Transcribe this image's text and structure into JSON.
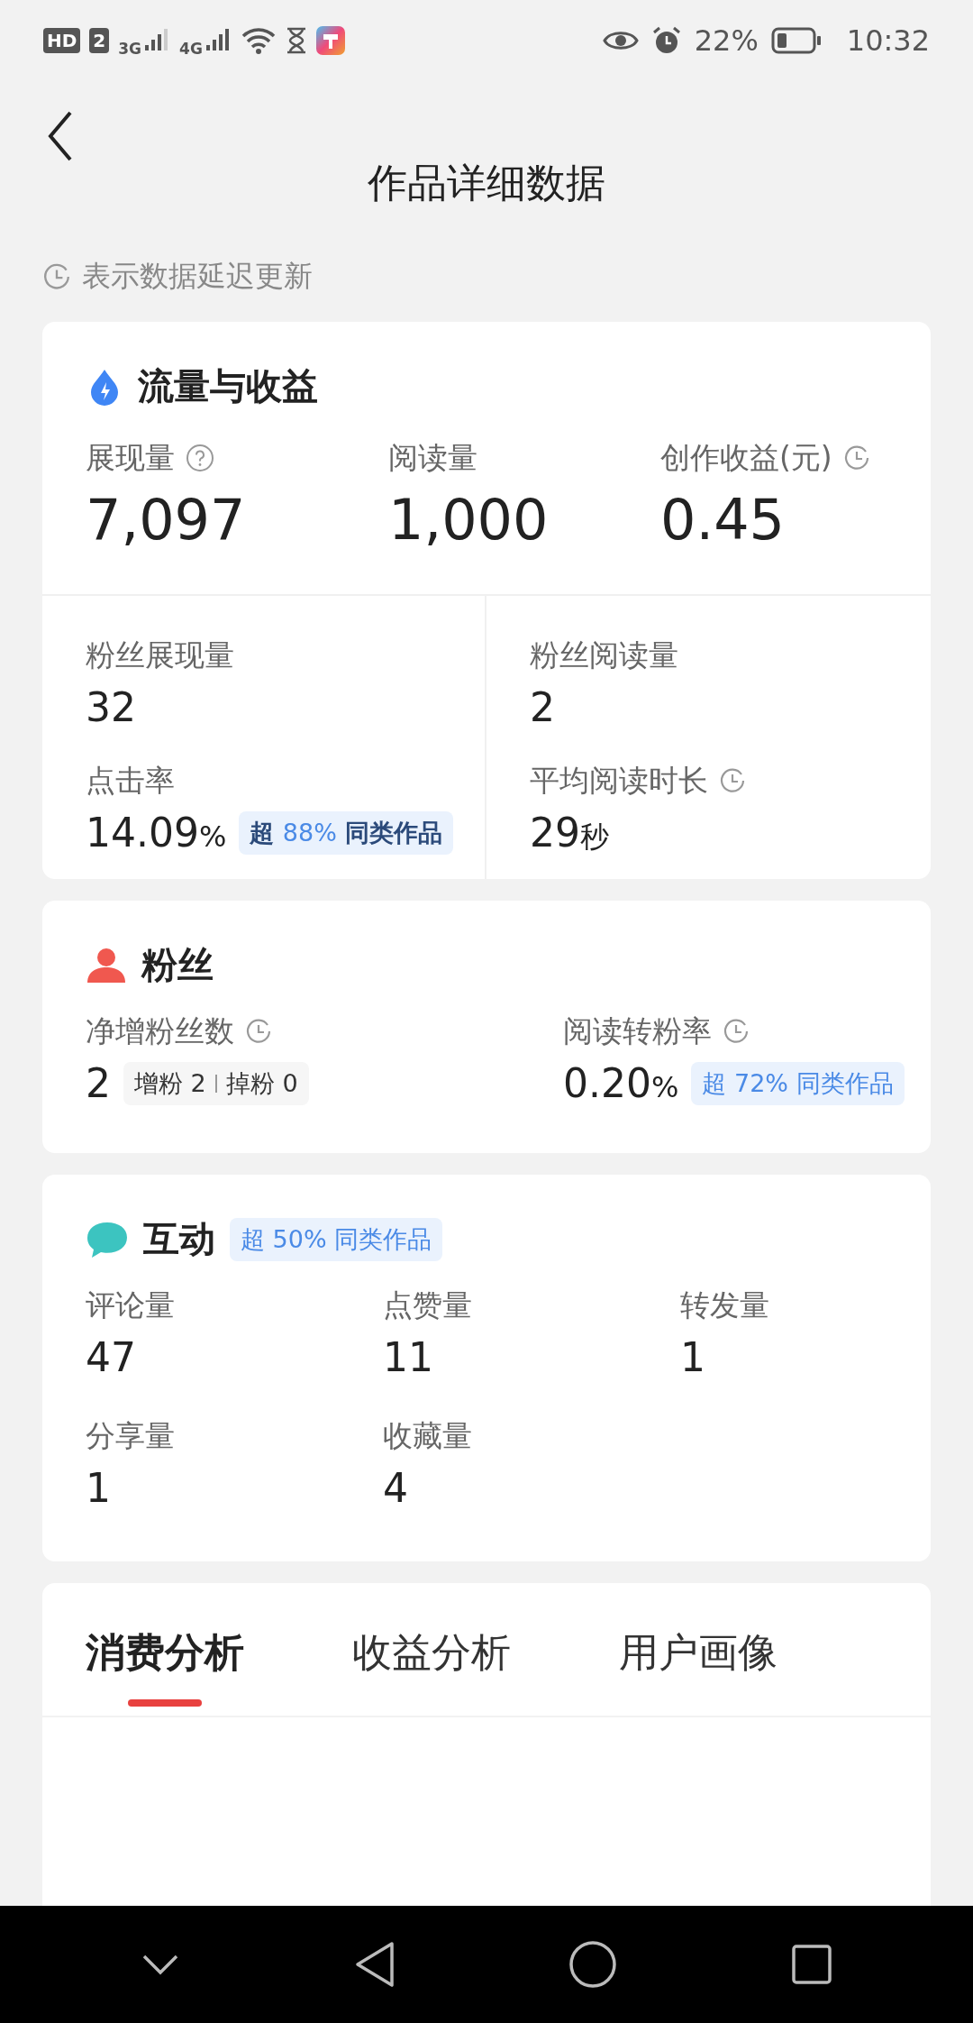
{
  "status_bar": {
    "sim_badges": [
      "HD",
      "2"
    ],
    "networks": [
      "3G",
      "4G"
    ],
    "battery": "22%",
    "time": "10:32"
  },
  "header": {
    "title": "作品详细数据",
    "note": "表示数据延迟更新"
  },
  "traffic": {
    "title": "流量与收益",
    "main_metrics": [
      {
        "label": "展现量",
        "value": "7,097",
        "help": true,
        "delayed": false
      },
      {
        "label": "阅读量",
        "value": "1,000",
        "help": false,
        "delayed": false
      },
      {
        "label": "创作收益(元)",
        "value": "0.45",
        "help": false,
        "delayed": true
      }
    ],
    "sub_metrics": [
      {
        "label": "粉丝展现量",
        "value": "32",
        "delayed": false
      },
      {
        "label": "粉丝阅读量",
        "value": "2",
        "delayed": false
      },
      {
        "label": "点击率",
        "value": "14.09",
        "unit": "%",
        "delayed": false,
        "badge": {
          "emphasis": true,
          "lead": "超",
          "figure": "88%",
          "tail": "同类作品"
        }
      },
      {
        "label": "平均阅读时长",
        "value": "29",
        "unit": "秒",
        "delayed": true
      }
    ]
  },
  "fans": {
    "title": "粉丝",
    "metrics": [
      {
        "label": "净增粉丝数",
        "value": "2",
        "delayed": true,
        "chip": [
          {
            "label": "增粉",
            "value": "2"
          },
          {
            "label": "掉粉",
            "value": "0"
          }
        ]
      },
      {
        "label": "阅读转粉率",
        "value": "0.20",
        "unit": "%",
        "delayed": true,
        "badge": {
          "emphasis": false,
          "lead": "超",
          "figure": "72%",
          "tail": "同类作品"
        }
      }
    ]
  },
  "interaction": {
    "title": "互动",
    "badge": {
      "emphasis": false,
      "lead": "超",
      "figure": "50%",
      "tail": "同类作品"
    },
    "metrics": [
      {
        "label": "评论量",
        "value": "47",
        "delayed": false
      },
      {
        "label": "点赞量",
        "value": "11",
        "delayed": false
      },
      {
        "label": "转发量",
        "value": "1",
        "delayed": false
      },
      {
        "label": "分享量",
        "value": "1",
        "delayed": false
      },
      {
        "label": "收藏量",
        "value": "4",
        "delayed": false
      }
    ]
  },
  "tabs": [
    {
      "label": "消费分析",
      "selected": true
    },
    {
      "label": "收益分析",
      "selected": false
    },
    {
      "label": "用户画像",
      "selected": false
    }
  ]
}
